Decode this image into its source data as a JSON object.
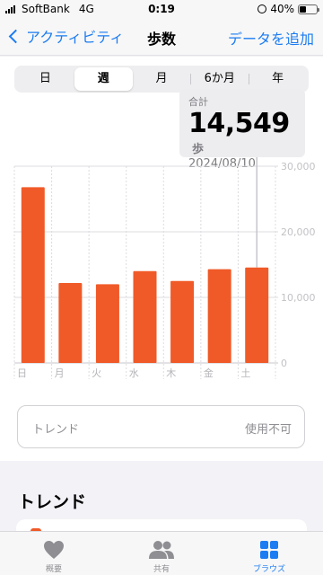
{
  "status_bar": {
    "carrier": "SoftBank",
    "network": "4G",
    "time": "0:19",
    "battery": "40%",
    "battery_level": 0.4
  },
  "nav": {
    "back_label": "アクティビティ",
    "title": "歩数",
    "add_label": "データを追加"
  },
  "segments": [
    {
      "label": "日",
      "active": false
    },
    {
      "label": "週",
      "active": true
    },
    {
      "label": "月",
      "active": false
    },
    {
      "label": "6か月",
      "active": false
    },
    {
      "label": "年",
      "active": false
    }
  ],
  "callout": {
    "label": "合計",
    "value": "14,549",
    "unit": "歩",
    "date": "2024/08/10"
  },
  "chart_data": {
    "type": "bar",
    "categories": [
      "日",
      "月",
      "火",
      "水",
      "木",
      "金",
      "土"
    ],
    "values": [
      26800,
      12200,
      12000,
      14000,
      12500,
      14300,
      14549
    ],
    "y_ticks": [
      "30,000",
      "20,000",
      "10,000",
      "0"
    ],
    "ylim": [
      0,
      30000
    ],
    "selected_index": 6,
    "color": "#f05a28",
    "grid": true
  },
  "trend_box": {
    "label": "トレンド",
    "status": "使用不可"
  },
  "section": {
    "title": "トレンド"
  },
  "tabs": [
    {
      "label": "概要",
      "icon": "heart-icon",
      "active": false
    },
    {
      "label": "共有",
      "icon": "people-icon",
      "active": false
    },
    {
      "label": "ブラウズ",
      "icon": "grid-icon",
      "active": true
    }
  ],
  "colors": {
    "accent": "#1c7cf2",
    "bar": "#f05a28",
    "tab_inactive": "#8e8e93"
  }
}
